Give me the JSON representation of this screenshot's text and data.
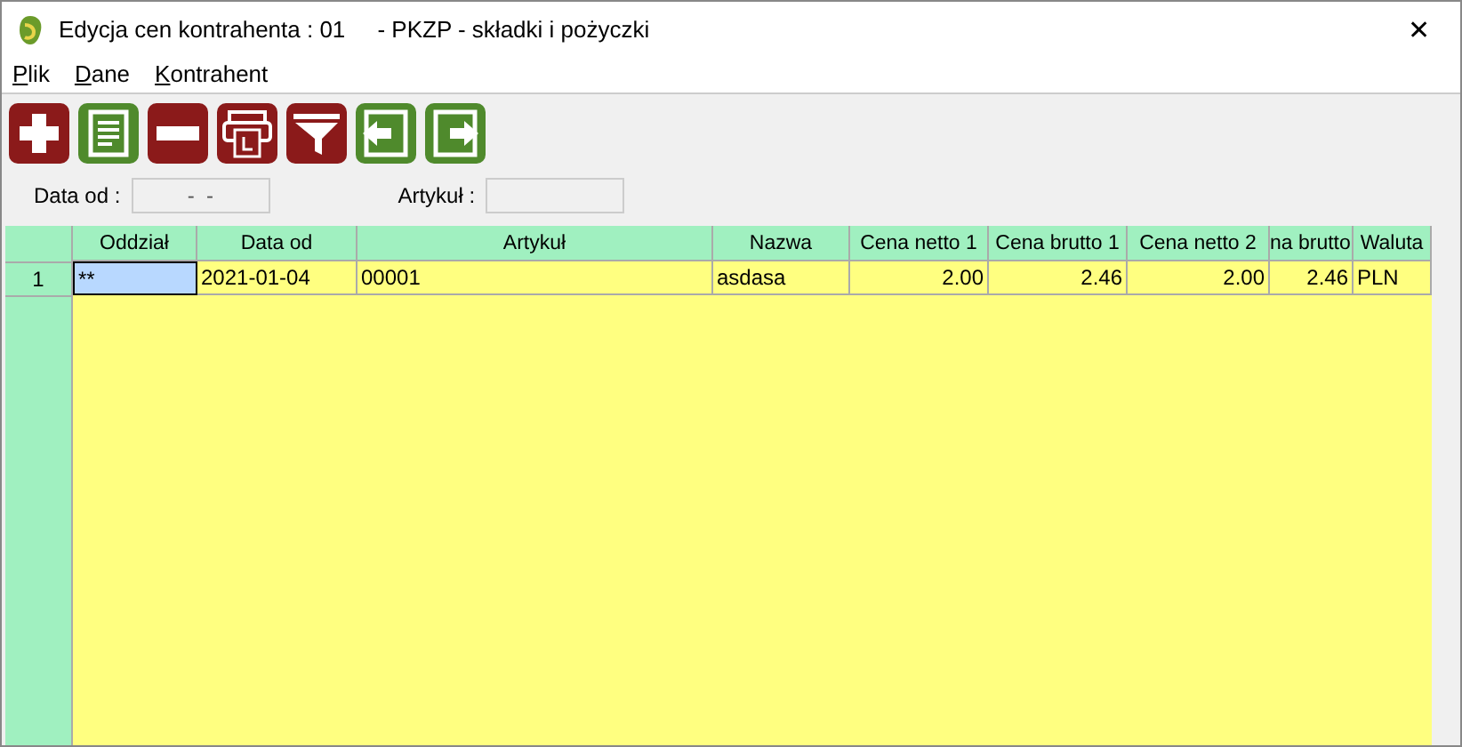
{
  "window": {
    "title": "Edycja cen kontrahenta : 01     - PKZP - składki i pożyczki",
    "close": "✕"
  },
  "menu": [
    "Plik",
    "Dane",
    "Kontrahent"
  ],
  "toolbar": [
    {
      "color": "#8b1a1a"
    },
    {
      "color": "#4f8a2c"
    },
    {
      "color": "#8b1a1a"
    },
    {
      "color": "#8b1a1a"
    },
    {
      "color": "#8b1a1a"
    },
    {
      "color": "#4f8a2c"
    },
    {
      "color": "#4f8a2c"
    }
  ],
  "filters": [
    {
      "label": "Data od :",
      "value": "-  -"
    },
    {
      "label": "Artykuł :"
    }
  ],
  "table": {
    "columns": [
      "Oddział",
      "Data od",
      "Artykuł",
      "Nazwa",
      "Cena netto 1",
      "Cena brutto 1",
      "Cena netto 2",
      "na brutto",
      "Waluta"
    ],
    "rows": [
      {
        "number": "1",
        "cells": [
          {
            "text": "**",
            "selected": true
          },
          {
            "text": "2021-01-04",
            "selected": false
          },
          {
            "text": "00001",
            "selected": false
          },
          {
            "text": "asdasa",
            "selected": false
          },
          {
            "text": "2.00",
            "selected": false
          },
          {
            "text": "2.46",
            "selected": false
          },
          {
            "text": "2.00",
            "selected": false
          },
          {
            "text": "2.46",
            "selected": false
          },
          {
            "text": "PLN",
            "selected": false
          }
        ]
      }
    ]
  }
}
